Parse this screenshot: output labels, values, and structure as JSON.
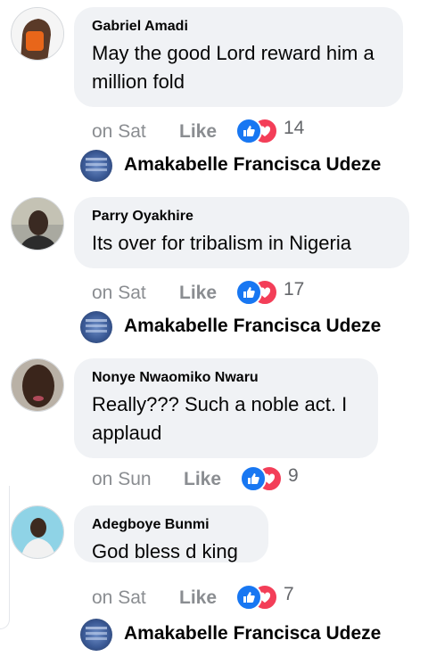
{
  "comments": [
    {
      "author": "Gabriel Amadi",
      "text": "May the good Lord reward him a million fold",
      "time": "on Sat",
      "like_label": "Like",
      "reaction_count": "14",
      "reply_author": "Amakabelle Francisca Udeze"
    },
    {
      "author": "Parry Oyakhire",
      "text": "Its over for tribalism in Nigeria",
      "time": "on Sat",
      "like_label": "Like",
      "reaction_count": "17",
      "reply_author": "Amakabelle Francisca Udeze"
    },
    {
      "author": "Nonye Nwaomiko Nwaru",
      "text": "Really??? Such a noble act. I applaud",
      "time": "on Sun",
      "like_label": "Like",
      "reaction_count": "9"
    },
    {
      "author": "Adegboye Bunmi",
      "text": "God bless d king",
      "time": "on Sat",
      "like_label": "Like",
      "reaction_count": "7",
      "reply_author": "Amakabelle Francisca Udeze"
    }
  ],
  "colors": {
    "bubble_bg": "#f0f2f5",
    "like_blue": "#1877f2",
    "love_red": "#f33e58",
    "meta_gray": "#8a8d91"
  },
  "icons": [
    "like-reaction-icon",
    "love-reaction-icon"
  ]
}
